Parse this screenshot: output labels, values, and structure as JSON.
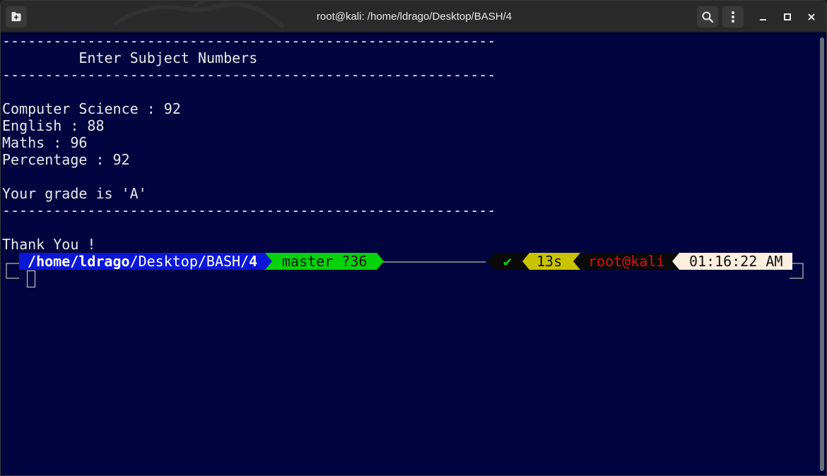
{
  "window": {
    "title": "root@kali: /home/ldrago/Desktop/BASH/4"
  },
  "terminal": {
    "lines": [
      "----------------------------------------------------------",
      "         Enter Subject Numbers",
      "----------------------------------------------------------",
      "",
      "Computer Science : 92",
      "English : 88",
      "Maths : 96",
      "Percentage : 92",
      "",
      "Your grade is 'A'",
      "----------------------------------------------------------",
      "",
      "Thank You !"
    ],
    "prompt": {
      "path_prefix": " /home/",
      "path_user": "ldrago",
      "path_rest": "/Desktop/BASH/",
      "path_last": "4",
      "git": "master ?36",
      "status": "✔",
      "duration": "13s",
      "user_host": "root@kali",
      "time": "01:16:22 AM"
    }
  },
  "colors": {
    "background": "#02043f",
    "path_bg": "#0b17d6",
    "git_bg": "#06d20a",
    "duration_bg": "#c9c400",
    "user_fg": "#e01010",
    "time_bg": "#fdefe0"
  },
  "icons": {
    "new_tab": "new-tab-icon",
    "search": "search-icon",
    "menu": "kebab-menu-icon",
    "minimize": "minimize-icon",
    "maximize": "maximize-icon",
    "close": "close-icon"
  }
}
